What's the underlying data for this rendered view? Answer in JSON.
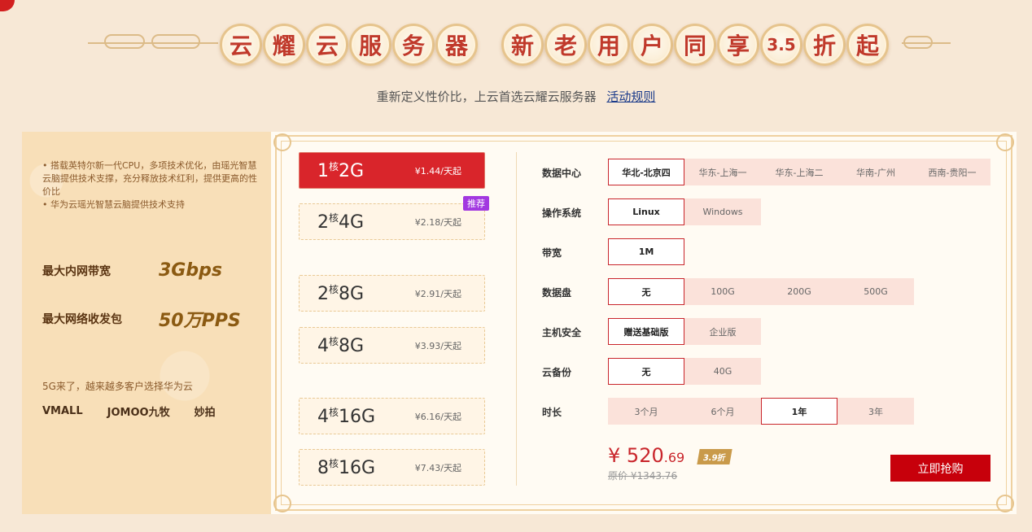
{
  "header": {
    "title_chars_1": [
      "云",
      "耀",
      "云",
      "服",
      "务",
      "器"
    ],
    "title_chars_2": [
      "新",
      "老",
      "用",
      "户",
      "同",
      "享",
      "3.5",
      "折",
      "起"
    ],
    "subtitle": "重新定义性价比，上云首选云耀云服务器",
    "rules_link": "活动规则"
  },
  "left_panel": {
    "features": [
      "• 搭载英特尔新一代CPU，多项技术优化，由瑶光智慧云脑提供技术支撑，充分释放技术红利，提供更高的性价比",
      "• 华为云瑶光智慧云脑提供技术支持"
    ],
    "stats": [
      {
        "label": "最大内网带宽",
        "value": "3Gbps"
      },
      {
        "label": "最大网络收发包",
        "value": "50万PPS"
      }
    ],
    "tagline": "5G来了，越来越多客户选择华为云",
    "logos": [
      "VMALL",
      "JOMOO九牧",
      "妙拍"
    ]
  },
  "specs": [
    {
      "cores": "1",
      "core_unit": "核",
      "mem": "2G",
      "price": "¥1.44/天起",
      "active": true
    },
    {
      "cores": "2",
      "core_unit": "核",
      "mem": "4G",
      "price": "¥2.18/天起",
      "badge": "推荐"
    },
    {
      "cores": "2",
      "core_unit": "核",
      "mem": "8G",
      "price": "¥2.91/天起"
    },
    {
      "cores": "4",
      "core_unit": "核",
      "mem": "8G",
      "price": "¥3.93/天起"
    },
    {
      "cores": "4",
      "core_unit": "核",
      "mem": "16G",
      "price": "¥6.16/天起"
    },
    {
      "cores": "8",
      "core_unit": "核",
      "mem": "16G",
      "price": "¥7.43/天起"
    }
  ],
  "options": {
    "datacenter": {
      "label": "数据中心",
      "items": [
        "华北-北京四",
        "华东-上海一",
        "华东-上海二",
        "华南-广州",
        "西南-贵阳一"
      ],
      "selected": 0
    },
    "os": {
      "label": "操作系统",
      "items": [
        "Linux",
        "Windows"
      ],
      "selected": 0
    },
    "bandwidth": {
      "label": "带宽",
      "items": [
        "1M"
      ],
      "selected": 0
    },
    "disk": {
      "label": "数据盘",
      "items": [
        "无",
        "100G",
        "200G",
        "500G"
      ],
      "selected": 0
    },
    "security": {
      "label": "主机安全",
      "items": [
        "赠送基础版",
        "企业版"
      ],
      "selected": 0
    },
    "backup": {
      "label": "云备份",
      "items": [
        "无",
        "40G"
      ],
      "selected": 0
    },
    "duration": {
      "label": "时长",
      "items": [
        "3个月",
        "6个月",
        "1年",
        "3年"
      ],
      "selected": 2
    }
  },
  "pricing": {
    "currency": "¥",
    "price_int": "520",
    "price_dec": ".69",
    "discount": "3.9折",
    "original": "原价 ¥1343.76",
    "buy_label": "立即抢购"
  },
  "colors": {
    "accent": "#c7000b",
    "bg": "#f7e8d6"
  }
}
